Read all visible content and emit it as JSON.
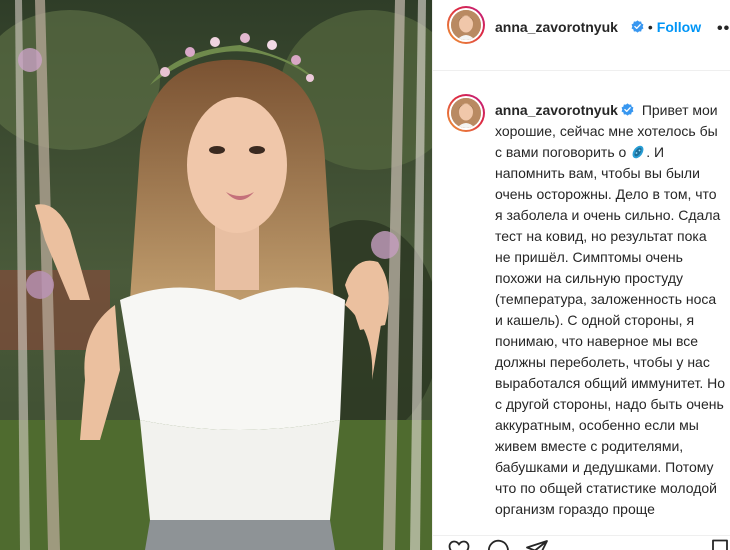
{
  "post": {
    "username": "anna_zavorotnyuk",
    "follow_label": "Follow",
    "separator": "•",
    "more_label": "••"
  },
  "caption": {
    "username": "anna_zavorotnyuk",
    "text_before_icon": "Привет мои хорошие, сейчас мне хотелось бы с вами поговорить о",
    "text_after_icon": ". И напомнить вам, чтобы вы были очень осторожны. Дело в том, что я заболела и очень сильно. Сдала тест на ковид, но результат пока не пришёл. Симптомы очень похожи на сильную простуду (температура, заложенность носа и кашель). С одной стороны, я понимаю, что наверное мы все должны переболеть, чтобы у нас выработался общий иммунитет. Но с другой стороны, надо быть очень аккуратным, особенно если мы живем вместе с родителями, бабушками и дедушками. Потому что по общей статистике молодой организм гораздо проще"
  },
  "colors": {
    "follow": "#0095f6",
    "verified": "#3897f0",
    "text": "#262626",
    "border": "#efefef"
  },
  "icons": {
    "verified": "verified-badge-icon",
    "microbe": "microbe-emoji-icon",
    "like": "heart-icon",
    "comment": "comment-icon",
    "share": "paper-plane-icon",
    "save": "bookmark-icon"
  }
}
